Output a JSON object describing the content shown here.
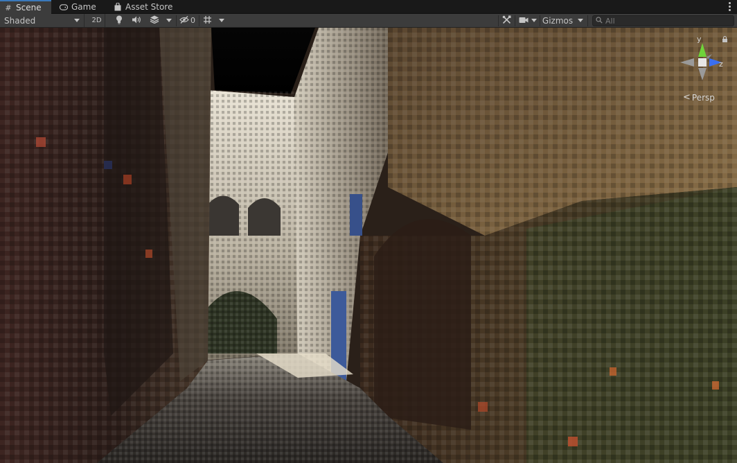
{
  "tabs": [
    {
      "label": "Scene",
      "icon": "hash-icon",
      "active": true
    },
    {
      "label": "Game",
      "icon": "gamepad-icon",
      "active": false
    },
    {
      "label": "Asset Store",
      "icon": "shopping-bag-icon",
      "active": false
    }
  ],
  "toolbar": {
    "draw_mode": "Shaded",
    "mode_2d_label": "2D",
    "hidden_count": "0",
    "gizmos_label": "Gizmos",
    "search_placeholder": "All"
  },
  "gizmo": {
    "y_label": "y",
    "z_label": "z",
    "projection_label": "Persp"
  },
  "colors": {
    "accent": "#3a79bb",
    "toolbar_bg": "#3c3c3c",
    "axis_y": "#6fd33a",
    "axis_z": "#3b6ff0",
    "axis_x": "#d84a3a"
  }
}
